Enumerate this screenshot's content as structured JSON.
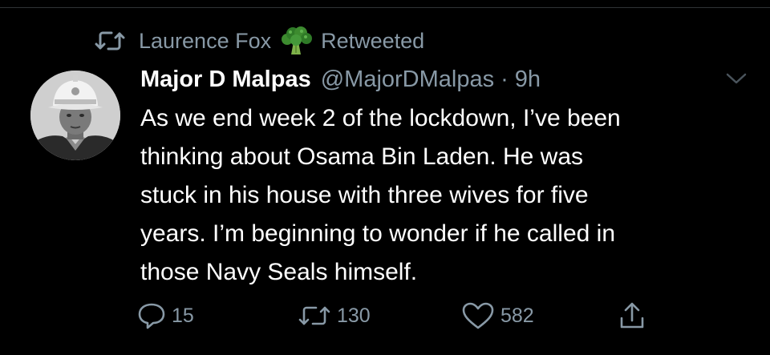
{
  "retweet_banner": {
    "icon": "retweet-icon",
    "user": "Laurence Fox",
    "emoji": "broccoli-emoji",
    "label": "Retweeted"
  },
  "tweet": {
    "display_name": "Major D Malpas",
    "handle": "@MajorDMalpas",
    "separator": "·",
    "time": "9h",
    "text_lines": [
      "As we end week 2 of the lockdown, I’ve been",
      "thinking about Osama Bin Laden. He was",
      "stuck in his house with three wives for five",
      "years. I’m beginning to wonder if he called in",
      "those Navy Seals himself."
    ]
  },
  "actions": {
    "reply_count": "15",
    "retweet_count": "130",
    "like_count": "582"
  },
  "colors": {
    "background": "#000000",
    "text": "#ffffff",
    "muted": "#8899a6",
    "divider": "#2f3336"
  }
}
